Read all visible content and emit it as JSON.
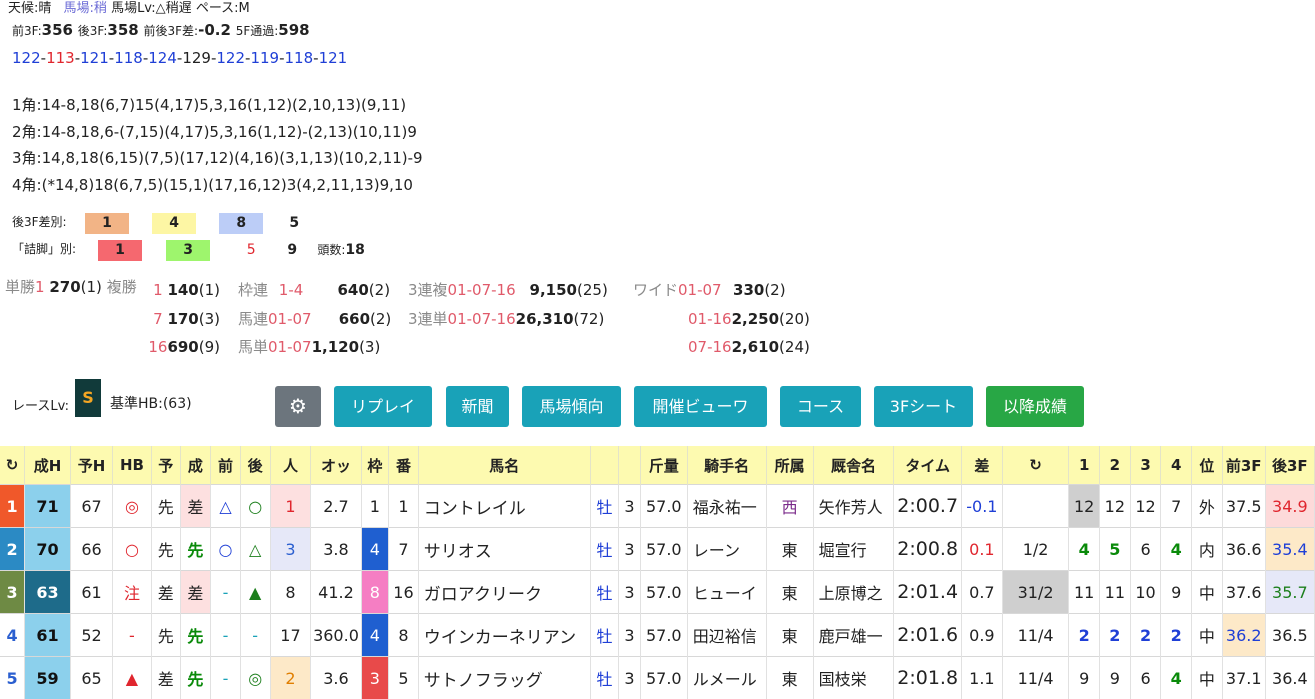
{
  "header": {
    "weather_label": "天候:晴",
    "track_label": "馬場:稍",
    "track_lv": "馬場Lv:△稍遅",
    "pace": "ペース:M",
    "f3_front_label": "前3F:",
    "f3_front": "356",
    "f3_back_label": "後3F:",
    "f3_back": "358",
    "diff_label": "前後3F差:",
    "diff": "-0.2",
    "pass5_label": "5F通過:",
    "pass5": "598"
  },
  "laps": [
    "122",
    "113",
    "121",
    "118",
    "124",
    "129",
    "122",
    "119",
    "118",
    "121"
  ],
  "corners": [
    "1角:14-8,18(6,7)15(4,17)5,3,16(1,12)(2,10,13)(9,11)",
    "2角:14-8,18,6-(7,15)(4,17)5,3,16(1,12)-(2,13)(10,11)9",
    "3角:14,8,18(6,15)(7,5)(17,12)(4,16)(3,1,13)(10,2,11)-9",
    "4角:(*14,8)18(6,7,5)(15,1)(17,16,12)3(4,2,11,13)9,10"
  ],
  "after3f": {
    "label": "後3F差別:",
    "c1": "1",
    "c2": "4",
    "c3": "8",
    "c4": "5"
  },
  "tsume": {
    "label": "「詰脚」別:",
    "c1": "1",
    "c2": "3",
    "c3": "5",
    "c4": "9",
    "count_label": "頭数:",
    "count": "18"
  },
  "payouts": {
    "tansho_label": "単勝",
    "tansho_num": "1",
    "tansho_val": "270",
    "tansho_pop": "(1)",
    "fukusho_label": "複勝",
    "fukusho": [
      {
        "num": "1",
        "val": "140",
        "pop": "(1)"
      },
      {
        "num": "7",
        "val": "170",
        "pop": "(3)"
      },
      {
        "num": "16",
        "val": "690",
        "pop": "(9)"
      }
    ],
    "wakuren_label": "枠連",
    "wakuren_num": "1-4",
    "wakuren_val": "640",
    "wakuren_pop": "(2)",
    "umaren_label": "馬連",
    "umaren_num": "01-07",
    "umaren_val": "660",
    "umaren_pop": "(2)",
    "umatan_label": "馬単",
    "umatan_num": "01-07",
    "umatan_val": "1,120",
    "umatan_pop": "(3)",
    "sanrenpuku_label": "3連複",
    "sanrenpuku_num": "01-07-16",
    "sanrenpuku_val": "9,150",
    "sanrenpuku_pop": "(25)",
    "sanrentan_label": "3連単",
    "sanrentan_num": "01-07-16",
    "sanrentan_val": "26,310",
    "sanrentan_pop": "(72)",
    "wide_label": "ワイド",
    "wide": [
      {
        "num": "01-07",
        "val": "330",
        "pop": "(2)"
      },
      {
        "num": "01-16",
        "val": "2,250",
        "pop": "(20)"
      },
      {
        "num": "07-16",
        "val": "2,610",
        "pop": "(24)"
      }
    ]
  },
  "race": {
    "lv_label": "レースLv:",
    "lv": "S",
    "hb_label": "基準HB:(63)"
  },
  "buttons": {
    "settings_icon": "gear-icon",
    "replay": "リプレイ",
    "news": "新聞",
    "track_trend": "馬場傾向",
    "viewer": "開催ビューワ",
    "course": "コース",
    "sheet3f": "3Fシート",
    "later": "以降成績"
  },
  "table": {
    "headers": [
      "↻",
      "成H",
      "予H",
      "HB",
      "予",
      "成",
      "前",
      "後",
      "人",
      "オッ",
      "枠",
      "番",
      "馬名",
      "",
      "",
      "斤量",
      "騎手名",
      "所属",
      "厩舎名",
      "タイム",
      "差",
      "↻",
      "1",
      "2",
      "3",
      "4",
      "位",
      "前3F",
      "後3F"
    ],
    "rows": [
      {
        "rank": "1",
        "sh": "71",
        "yh": "67",
        "hb": "◎",
        "yo": "先",
        "sei": "差",
        "mae": "△",
        "ato": "○",
        "pop": "1",
        "odds": "2.7",
        "waku": "1",
        "num": "1",
        "name": "コントレイル",
        "sex": "牡",
        "age": "3",
        "kin": "57.0",
        "jockey": "福永祐一",
        "aff": "西",
        "trainer": "矢作芳人",
        "time": "2:00.7",
        "diff": "-0.1",
        "cr": "",
        "c1": "12",
        "c2": "12",
        "c3": "12",
        "c4": "7",
        "pos": "外",
        "f3": "37.5",
        "b3": "34.9"
      },
      {
        "rank": "2",
        "sh": "70",
        "yh": "66",
        "hb": "○",
        "yo": "先",
        "sei": "先",
        "mae": "○",
        "ato": "△",
        "pop": "3",
        "odds": "3.8",
        "waku": "4",
        "num": "7",
        "name": "サリオス",
        "sex": "牡",
        "age": "3",
        "kin": "57.0",
        "jockey": "レーン",
        "aff": "東",
        "trainer": "堀宣行",
        "time": "2:00.8",
        "diff": "0.1",
        "cr": "1/2",
        "c1": "4",
        "c2": "5",
        "c3": "6",
        "c4": "4",
        "pos": "内",
        "f3": "36.6",
        "b3": "35.4"
      },
      {
        "rank": "3",
        "sh": "63",
        "yh": "61",
        "hb": "注",
        "yo": "差",
        "sei": "差",
        "mae": "-",
        "ato": "▲",
        "pop": "8",
        "odds": "41.2",
        "waku": "8",
        "num": "16",
        "name": "ガロアクリーク",
        "sex": "牡",
        "age": "3",
        "kin": "57.0",
        "jockey": "ヒューイ",
        "aff": "東",
        "trainer": "上原博之",
        "time": "2:01.4",
        "diff": "0.7",
        "cr": "31/2",
        "c1": "11",
        "c2": "11",
        "c3": "10",
        "c4": "9",
        "pos": "中",
        "f3": "37.6",
        "b3": "35.7"
      },
      {
        "rank": "4",
        "sh": "61",
        "yh": "52",
        "hb": "-",
        "yo": "先",
        "sei": "先",
        "mae": "-",
        "ato": "-",
        "pop": "17",
        "odds": "360.0",
        "waku": "4",
        "num": "8",
        "name": "ウインカーネリアン",
        "sex": "牡",
        "age": "3",
        "kin": "57.0",
        "jockey": "田辺裕信",
        "aff": "東",
        "trainer": "鹿戸雄一",
        "time": "2:01.6",
        "diff": "0.9",
        "cr": "11/4",
        "c1": "2",
        "c2": "2",
        "c3": "2",
        "c4": "2",
        "pos": "中",
        "f3": "36.2",
        "b3": "36.5"
      },
      {
        "rank": "5",
        "sh": "59",
        "yh": "65",
        "hb": "▲",
        "yo": "差",
        "sei": "先",
        "mae": "-",
        "ato": "◎",
        "pop": "2",
        "odds": "3.6",
        "waku": "3",
        "num": "5",
        "name": "サトノフラッグ",
        "sex": "牡",
        "age": "3",
        "kin": "57.0",
        "jockey": "ルメール",
        "aff": "東",
        "trainer": "国枝栄",
        "time": "2:01.8",
        "diff": "1.1",
        "cr": "11/4",
        "c1": "9",
        "c2": "9",
        "c3": "6",
        "c4": "4",
        "pos": "中",
        "f3": "37.1",
        "b3": "36.4"
      }
    ]
  },
  "colors": {
    "accent": "#19a2b8",
    "green_button": "#28a745",
    "gray_button": "#6c757d",
    "header_bg": "#fdfab0"
  }
}
